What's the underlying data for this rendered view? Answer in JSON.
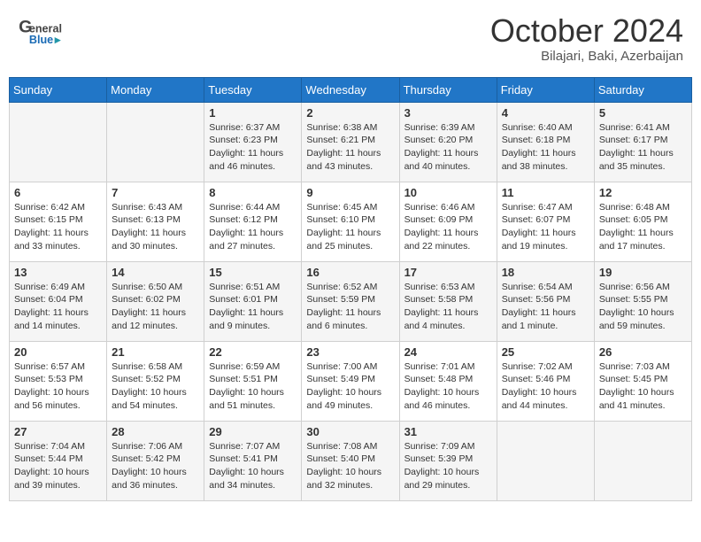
{
  "header": {
    "logo_general": "General",
    "logo_blue": "Blue",
    "month_title": "October 2024",
    "subtitle": "Bilajari, Baki, Azerbaijan"
  },
  "days_of_week": [
    "Sunday",
    "Monday",
    "Tuesday",
    "Wednesday",
    "Thursday",
    "Friday",
    "Saturday"
  ],
  "weeks": [
    [
      {
        "day": "",
        "info": ""
      },
      {
        "day": "",
        "info": ""
      },
      {
        "day": "1",
        "info": "Sunrise: 6:37 AM\nSunset: 6:23 PM\nDaylight: 11 hours and 46 minutes."
      },
      {
        "day": "2",
        "info": "Sunrise: 6:38 AM\nSunset: 6:21 PM\nDaylight: 11 hours and 43 minutes."
      },
      {
        "day": "3",
        "info": "Sunrise: 6:39 AM\nSunset: 6:20 PM\nDaylight: 11 hours and 40 minutes."
      },
      {
        "day": "4",
        "info": "Sunrise: 6:40 AM\nSunset: 6:18 PM\nDaylight: 11 hours and 38 minutes."
      },
      {
        "day": "5",
        "info": "Sunrise: 6:41 AM\nSunset: 6:17 PM\nDaylight: 11 hours and 35 minutes."
      }
    ],
    [
      {
        "day": "6",
        "info": "Sunrise: 6:42 AM\nSunset: 6:15 PM\nDaylight: 11 hours and 33 minutes."
      },
      {
        "day": "7",
        "info": "Sunrise: 6:43 AM\nSunset: 6:13 PM\nDaylight: 11 hours and 30 minutes."
      },
      {
        "day": "8",
        "info": "Sunrise: 6:44 AM\nSunset: 6:12 PM\nDaylight: 11 hours and 27 minutes."
      },
      {
        "day": "9",
        "info": "Sunrise: 6:45 AM\nSunset: 6:10 PM\nDaylight: 11 hours and 25 minutes."
      },
      {
        "day": "10",
        "info": "Sunrise: 6:46 AM\nSunset: 6:09 PM\nDaylight: 11 hours and 22 minutes."
      },
      {
        "day": "11",
        "info": "Sunrise: 6:47 AM\nSunset: 6:07 PM\nDaylight: 11 hours and 19 minutes."
      },
      {
        "day": "12",
        "info": "Sunrise: 6:48 AM\nSunset: 6:05 PM\nDaylight: 11 hours and 17 minutes."
      }
    ],
    [
      {
        "day": "13",
        "info": "Sunrise: 6:49 AM\nSunset: 6:04 PM\nDaylight: 11 hours and 14 minutes."
      },
      {
        "day": "14",
        "info": "Sunrise: 6:50 AM\nSunset: 6:02 PM\nDaylight: 11 hours and 12 minutes."
      },
      {
        "day": "15",
        "info": "Sunrise: 6:51 AM\nSunset: 6:01 PM\nDaylight: 11 hours and 9 minutes."
      },
      {
        "day": "16",
        "info": "Sunrise: 6:52 AM\nSunset: 5:59 PM\nDaylight: 11 hours and 6 minutes."
      },
      {
        "day": "17",
        "info": "Sunrise: 6:53 AM\nSunset: 5:58 PM\nDaylight: 11 hours and 4 minutes."
      },
      {
        "day": "18",
        "info": "Sunrise: 6:54 AM\nSunset: 5:56 PM\nDaylight: 11 hours and 1 minute."
      },
      {
        "day": "19",
        "info": "Sunrise: 6:56 AM\nSunset: 5:55 PM\nDaylight: 10 hours and 59 minutes."
      }
    ],
    [
      {
        "day": "20",
        "info": "Sunrise: 6:57 AM\nSunset: 5:53 PM\nDaylight: 10 hours and 56 minutes."
      },
      {
        "day": "21",
        "info": "Sunrise: 6:58 AM\nSunset: 5:52 PM\nDaylight: 10 hours and 54 minutes."
      },
      {
        "day": "22",
        "info": "Sunrise: 6:59 AM\nSunset: 5:51 PM\nDaylight: 10 hours and 51 minutes."
      },
      {
        "day": "23",
        "info": "Sunrise: 7:00 AM\nSunset: 5:49 PM\nDaylight: 10 hours and 49 minutes."
      },
      {
        "day": "24",
        "info": "Sunrise: 7:01 AM\nSunset: 5:48 PM\nDaylight: 10 hours and 46 minutes."
      },
      {
        "day": "25",
        "info": "Sunrise: 7:02 AM\nSunset: 5:46 PM\nDaylight: 10 hours and 44 minutes."
      },
      {
        "day": "26",
        "info": "Sunrise: 7:03 AM\nSunset: 5:45 PM\nDaylight: 10 hours and 41 minutes."
      }
    ],
    [
      {
        "day": "27",
        "info": "Sunrise: 7:04 AM\nSunset: 5:44 PM\nDaylight: 10 hours and 39 minutes."
      },
      {
        "day": "28",
        "info": "Sunrise: 7:06 AM\nSunset: 5:42 PM\nDaylight: 10 hours and 36 minutes."
      },
      {
        "day": "29",
        "info": "Sunrise: 7:07 AM\nSunset: 5:41 PM\nDaylight: 10 hours and 34 minutes."
      },
      {
        "day": "30",
        "info": "Sunrise: 7:08 AM\nSunset: 5:40 PM\nDaylight: 10 hours and 32 minutes."
      },
      {
        "day": "31",
        "info": "Sunrise: 7:09 AM\nSunset: 5:39 PM\nDaylight: 10 hours and 29 minutes."
      },
      {
        "day": "",
        "info": ""
      },
      {
        "day": "",
        "info": ""
      }
    ]
  ]
}
